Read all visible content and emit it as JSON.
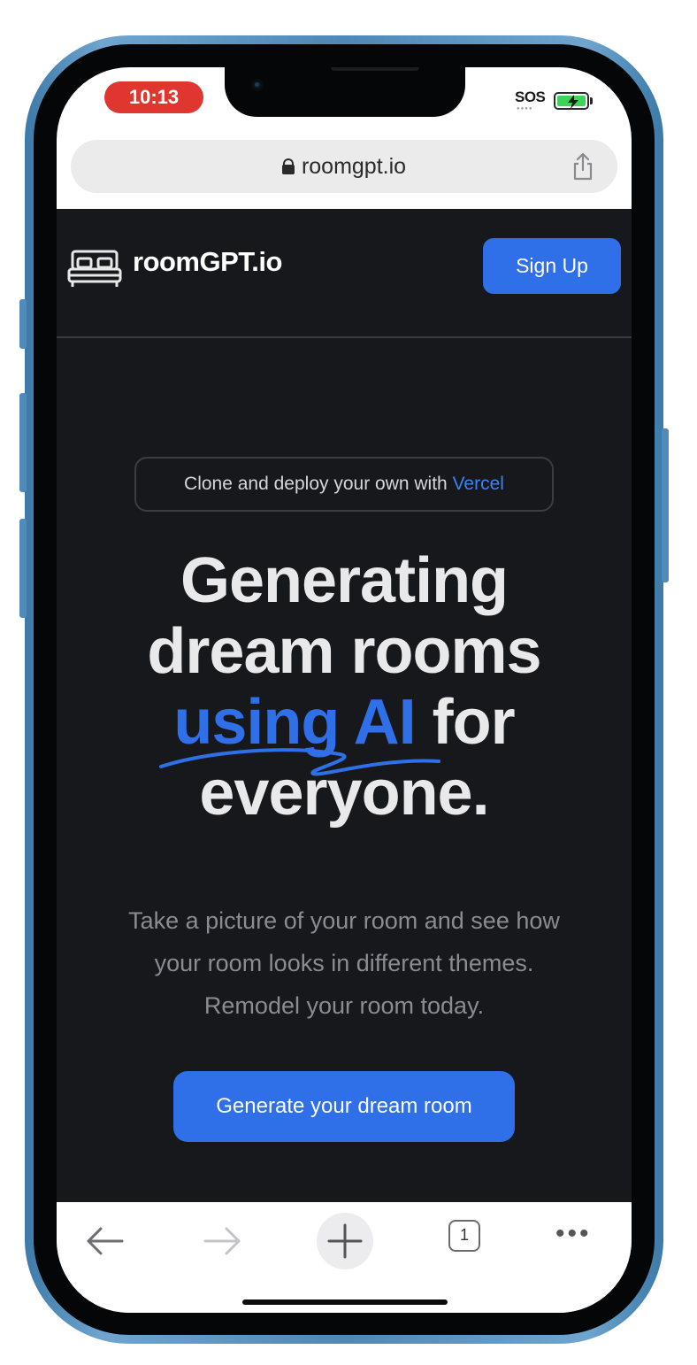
{
  "status_bar": {
    "time": "10:13",
    "sos": "SOS",
    "battery_icon": "battery-charging-icon"
  },
  "url_bar": {
    "url": "roomgpt.io",
    "lock_icon": "lock-icon",
    "share_icon": "share-icon"
  },
  "nav": {
    "logo_icon": "bed-icon",
    "brand": "roomGPT.io",
    "signup_label": "Sign Up"
  },
  "hero": {
    "clone_text": "Clone and deploy your own with ",
    "clone_link": "Vercel",
    "headline_line1": "Generating",
    "headline_line2": "dream rooms",
    "headline_accent": "using AI",
    "headline_line3_rest": " for",
    "headline_line4": "everyone.",
    "subtitle_line1": "Take a picture of your room and see how",
    "subtitle_line2": "your room looks in different themes.",
    "subtitle_line3": "Remodel your room today.",
    "cta_label": "Generate your dream room"
  },
  "toolbar": {
    "back_icon": "arrow-left-icon",
    "forward_icon": "arrow-right-icon",
    "new_tab_icon": "plus-icon",
    "tab_count": "1",
    "more_icon": "more-dots-icon"
  },
  "colors": {
    "accent": "#2f6fe8",
    "page_bg": "#17181c",
    "time_pill": "#e03630",
    "frame": "#4f8ab8"
  }
}
